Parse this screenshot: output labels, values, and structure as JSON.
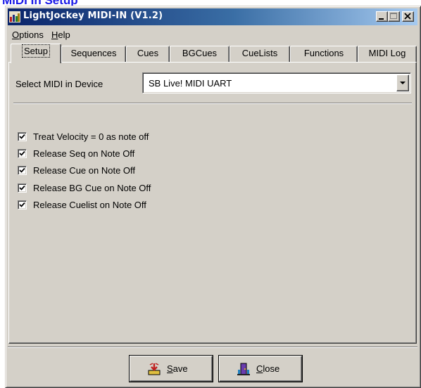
{
  "page": {
    "heading": "MIDI In Setup"
  },
  "window": {
    "title": "LightJockey MIDI-IN (V1.2)",
    "controls": {
      "minimize": "minimize-icon",
      "maximize": "maximize-icon",
      "close": "close-icon"
    }
  },
  "menu": {
    "items": [
      {
        "first": "O",
        "rest": "ptions"
      },
      {
        "first": "H",
        "rest": "elp"
      }
    ]
  },
  "tabs": [
    {
      "label": "Setup",
      "active": true
    },
    {
      "label": "Sequences",
      "active": false
    },
    {
      "label": "Cues",
      "active": false
    },
    {
      "label": "BGCues",
      "active": false
    },
    {
      "label": "CueLists",
      "active": false
    },
    {
      "label": "Functions",
      "active": false
    },
    {
      "label": "MIDI Log",
      "active": false
    }
  ],
  "setup": {
    "device_label": "Select MIDI in Device",
    "device_value": "SB Live! MIDI UART",
    "options": [
      {
        "label": "Treat Velocity = 0 as note off",
        "checked": true
      },
      {
        "label": "Release Seq on Note Off",
        "checked": true
      },
      {
        "label": "Release Cue on Note Off",
        "checked": true
      },
      {
        "label": "Release BG Cue on Note Off",
        "checked": true
      },
      {
        "label": "Release Cuelist on Note Off",
        "checked": true
      }
    ]
  },
  "buttons": {
    "save": {
      "first": "S",
      "rest": "ave",
      "icon": "save-icon"
    },
    "close": {
      "first": "C",
      "rest": "lose",
      "icon": "exit-door-icon"
    }
  },
  "colors": {
    "heading": "#1a1ae8",
    "title_gradient_start": "#0a246a",
    "title_gradient_end": "#a6caf0",
    "face": "#d4d0c8"
  }
}
